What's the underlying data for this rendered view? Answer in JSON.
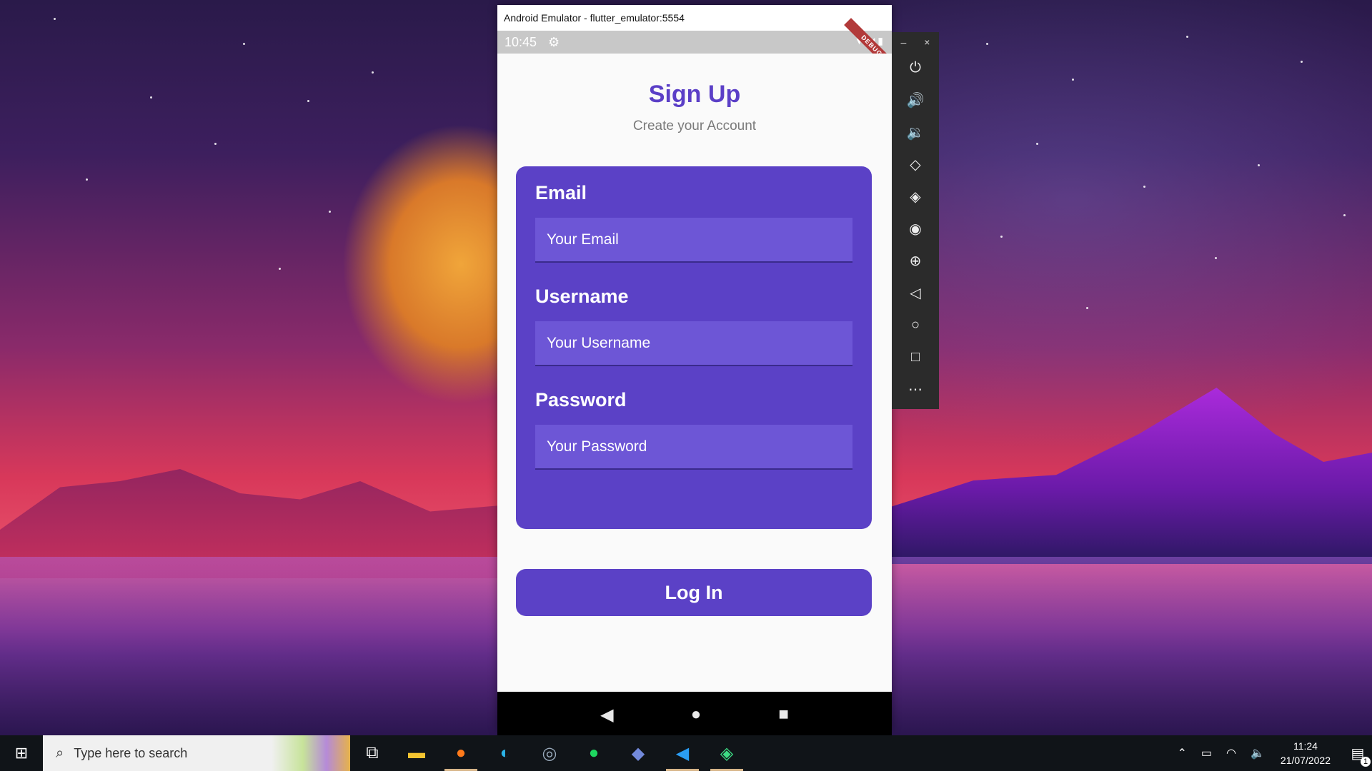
{
  "emulator": {
    "window_title": "Android Emulator - flutter_emulator:5554",
    "status_time": "10:45",
    "debug_label": "DEBUG"
  },
  "app": {
    "title": "Sign Up",
    "subtitle": "Create your Account",
    "fields": [
      {
        "label": "Email",
        "placeholder": "Your Email"
      },
      {
        "label": "Username",
        "placeholder": "Your Username"
      },
      {
        "label": "Password",
        "placeholder": "Your Password"
      }
    ],
    "login_button": "Log In",
    "colors": {
      "primary": "#5b41c6",
      "field": "#6d56d6"
    }
  },
  "nav": {
    "back": "◀",
    "home": "●",
    "recents": "■"
  },
  "side_toolbar": {
    "minimize": "–",
    "close": "×",
    "tools": [
      "power-icon",
      "volume-up-icon",
      "volume-down-icon",
      "rotate-left-icon",
      "rotate-right-icon",
      "camera-icon",
      "zoom-icon",
      "back-icon",
      "home-icon",
      "overview-icon",
      "more-icon"
    ]
  },
  "taskbar": {
    "search_placeholder": "Type here to search",
    "apps": [
      "task-view-icon",
      "file-explorer-icon",
      "firefox-icon",
      "edge-icon",
      "steam-icon",
      "spotify-icon",
      "discord-icon",
      "vscode-icon",
      "android-studio-icon"
    ],
    "clock_time": "11:24",
    "clock_date": "21/07/2022",
    "notification_count": "1"
  }
}
